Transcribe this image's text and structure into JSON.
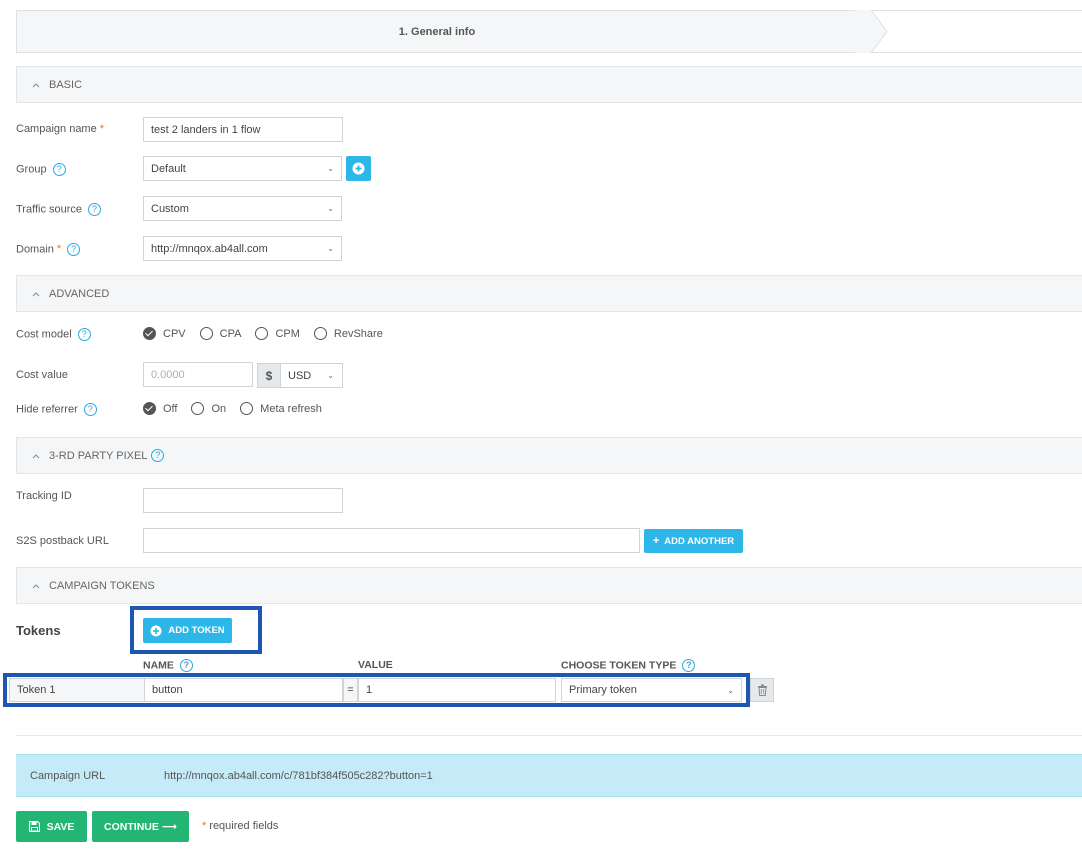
{
  "wizard": {
    "step1": "1. General info"
  },
  "sections": {
    "basic": "BASIC",
    "advanced": "ADVANCED",
    "pixel": "3-RD PARTY PIXEL",
    "tokens": "CAMPAIGN TOKENS"
  },
  "basic": {
    "campaign_name_label": "Campaign name",
    "campaign_name_value": "test 2 landers in 1 flow",
    "group_label": "Group",
    "group_value": "Default",
    "traffic_source_label": "Traffic source",
    "traffic_source_value": "Custom",
    "domain_label": "Domain",
    "domain_value": "http://mnqox.ab4all.com",
    "required_mark": "*"
  },
  "advanced": {
    "cost_model_label": "Cost model",
    "cost_model_options": [
      "CPV",
      "CPA",
      "CPM",
      "RevShare"
    ],
    "cost_model_selected": "CPV",
    "cost_value_label": "Cost value",
    "cost_value_placeholder": "0.0000",
    "currency_symbol": "$",
    "currency_value": "USD",
    "hide_referrer_label": "Hide referrer",
    "hide_referrer_options": [
      "Off",
      "On",
      "Meta refresh"
    ],
    "hide_referrer_selected": "Off"
  },
  "pixel": {
    "tracking_id_label": "Tracking ID",
    "tracking_id_value": "",
    "postback_label": "S2S postback URL",
    "postback_value": "",
    "add_another_label": "ADD ANOTHER"
  },
  "tokens": {
    "title": "Tokens",
    "add_token_label": "ADD TOKEN",
    "col_name": "NAME",
    "col_value": "VALUE",
    "col_type": "CHOOSE TOKEN TYPE",
    "rows": [
      {
        "label": "Token 1",
        "name": "button",
        "eq": "=",
        "value": "1",
        "type": "Primary token"
      }
    ]
  },
  "campaign_url": {
    "label": "Campaign URL",
    "value": "http://mnqox.ab4all.com/c/781bf384f505c282?button=1"
  },
  "footer": {
    "save_label": "SAVE",
    "continue_label": "CONTINUE",
    "continue_arrow": "⟶",
    "required_note_mark": "*",
    "required_note": "required fields"
  },
  "colors": {
    "accent_blue": "#2db7e8",
    "save_green": "#22b573",
    "highlight": "#1d57b3",
    "required": "#e8732a"
  }
}
